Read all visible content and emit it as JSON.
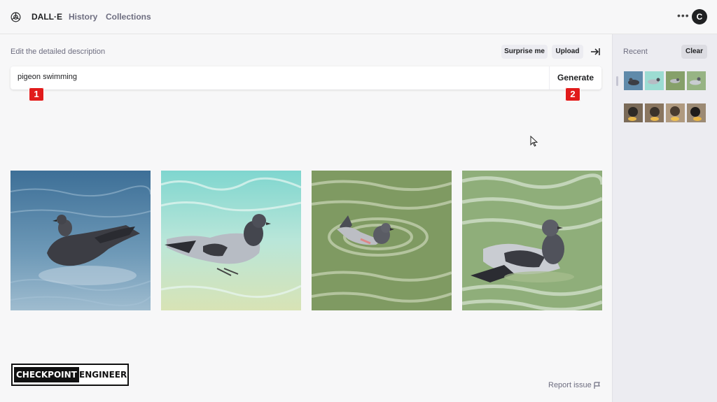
{
  "header": {
    "brand": "DALL·E",
    "nav": [
      "History",
      "Collections"
    ],
    "more_icon": "more-horizontal-icon",
    "avatar_letter": "C"
  },
  "prompt_area": {
    "label": "Edit the detailed description",
    "surprise_label": "Surprise me",
    "upload_label": "Upload",
    "collapse_icon": "collapse-right-icon",
    "input_value": "pigeon swimming",
    "generate_label": "Generate"
  },
  "annotations": {
    "badge_1": "1",
    "badge_2": "2",
    "badge_color": "#e11b1b"
  },
  "results": [
    {
      "name": "result-image-1",
      "description": "pigeon swimming"
    },
    {
      "name": "result-image-2",
      "description": "pigeon swimming"
    },
    {
      "name": "result-image-3",
      "description": "pigeon swimming"
    },
    {
      "name": "result-image-4",
      "description": "pigeon swimming"
    }
  ],
  "footer": {
    "watermark_dark": "CHECKPOINT",
    "watermark_light": "ENGINEER",
    "report_label": "Report issue"
  },
  "sidebar": {
    "recent_label": "Recent",
    "clear_label": "Clear",
    "thumbnail_rows": 2,
    "thumbnails_per_row": 4
  },
  "colors": {
    "background": "#f7f7f8",
    "sidebar": "#ececf1",
    "text": "#202123",
    "muted": "#6e6e80"
  }
}
